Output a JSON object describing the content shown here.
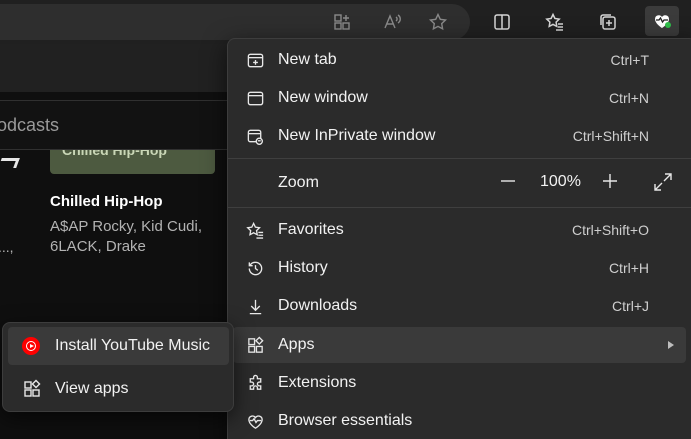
{
  "toolbar": {
    "icons": [
      "add-app-icon",
      "read-aloud-icon",
      "favorite-star-icon",
      "split-screen-icon",
      "favorites-icon",
      "collections-icon",
      "browser-essentials-icon"
    ]
  },
  "page": {
    "search_placeholder_fragment": "odcasts",
    "chip_fragment": "Chilled Hip-Hop",
    "card_title": "Chilled Hip-Hop",
    "card_subtitle": "A$AP Rocky, Kid Cudi, 6LACK, Drake",
    "left_fragment": "...,"
  },
  "menu": {
    "items": [
      {
        "label": "New tab",
        "shortcut": "Ctrl+T",
        "icon": "new-tab-icon"
      },
      {
        "label": "New window",
        "shortcut": "Ctrl+N",
        "icon": "new-window-icon"
      },
      {
        "label": "New InPrivate window",
        "shortcut": "Ctrl+Shift+N",
        "icon": "inprivate-icon"
      },
      {
        "label": "Zoom",
        "icon": "zoom"
      },
      {
        "label": "Favorites",
        "shortcut": "Ctrl+Shift+O",
        "icon": "favorites-icon"
      },
      {
        "label": "History",
        "shortcut": "Ctrl+H",
        "icon": "history-icon"
      },
      {
        "label": "Downloads",
        "shortcut": "Ctrl+J",
        "icon": "downloads-icon"
      },
      {
        "label": "Apps",
        "icon": "apps-icon"
      },
      {
        "label": "Extensions",
        "icon": "extensions-icon"
      },
      {
        "label": "Browser essentials",
        "icon": "browser-essentials-icon"
      }
    ],
    "zoom": {
      "value": "100%",
      "minus": "—",
      "plus": "+"
    }
  },
  "submenu": {
    "items": [
      {
        "label": "Install YouTube Music",
        "icon": "youtube-music-icon"
      },
      {
        "label": "View apps",
        "icon": "apps-icon"
      }
    ]
  }
}
